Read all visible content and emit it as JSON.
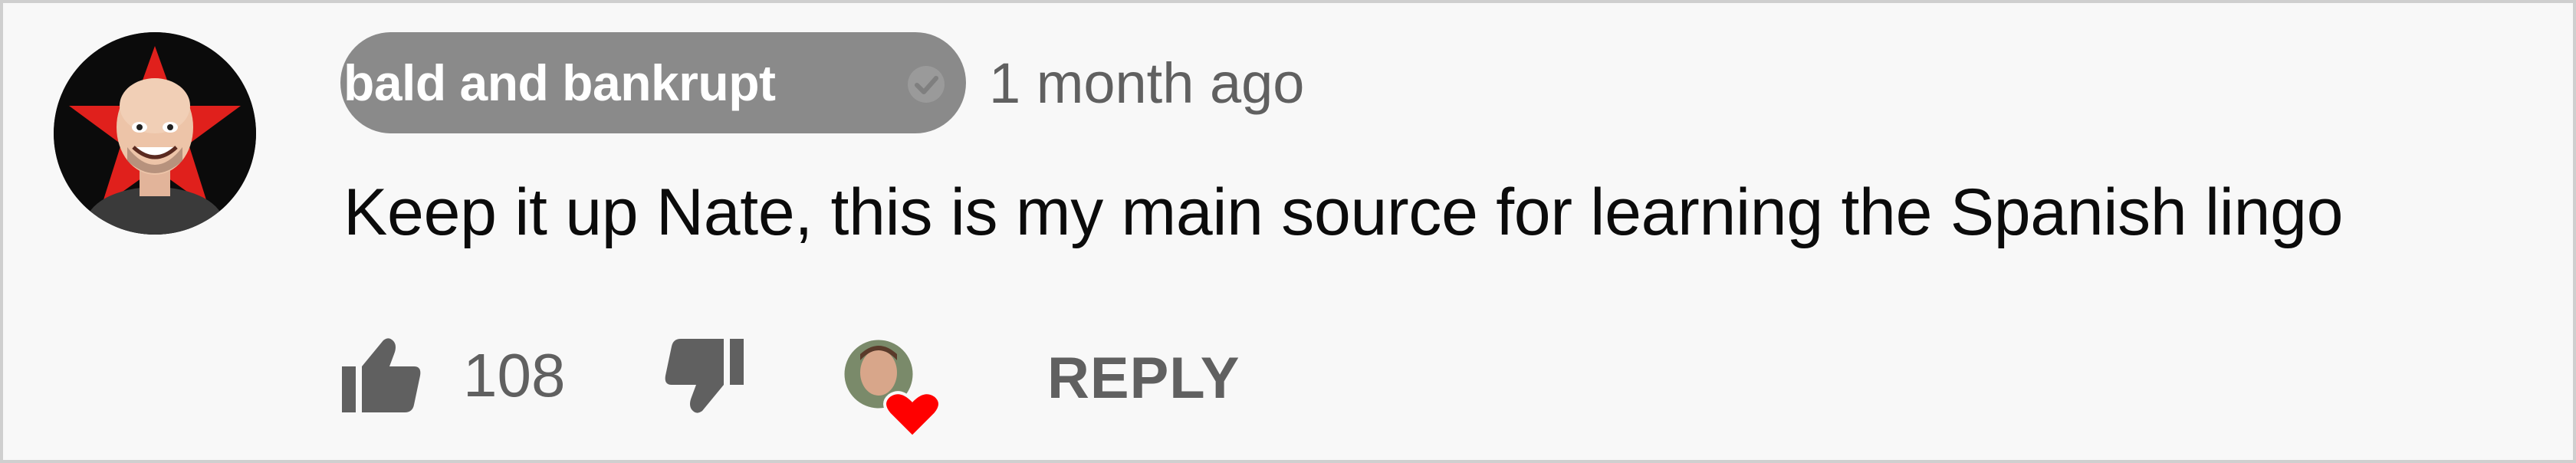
{
  "comment": {
    "author": "bald and bankrupt",
    "timestamp": "1 month ago",
    "text": "Keep it up Nate, this is my main source for learning the Spanish lingo",
    "like_count": "108",
    "reply_label": "REPLY"
  },
  "icons": {
    "avatar": "author-avatar",
    "verified": "checkmark-icon",
    "like": "thumbs-up-icon",
    "dislike": "thumbs-down-icon",
    "creator_heart": "creator-heart-icon"
  },
  "colors": {
    "background": "#f8f8f8",
    "author_chip": "#8a8a8a",
    "meta_text": "#606060",
    "comment_text": "#0b0b0b",
    "heart": "#ff0000",
    "avatar_star": "#e0201c"
  }
}
